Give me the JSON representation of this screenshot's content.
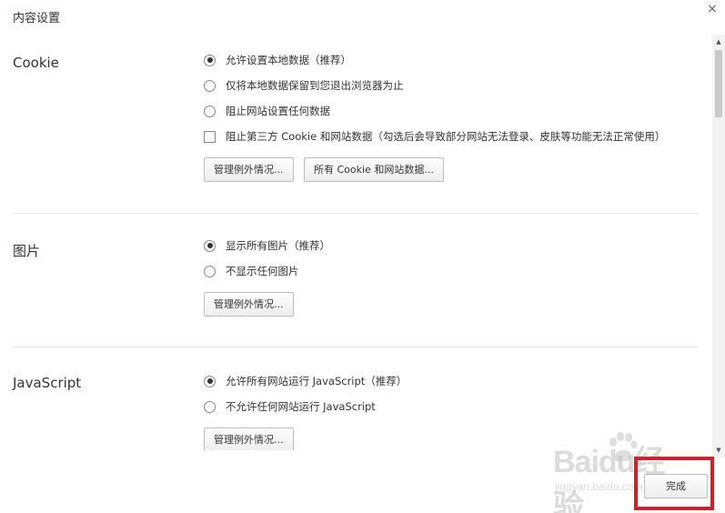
{
  "dialog": {
    "title": "内容设置",
    "close_glyph": "×"
  },
  "cookie": {
    "label": "Cookie",
    "options": [
      {
        "label": "允许设置本地数据（推荐）",
        "type": "radio",
        "checked": true
      },
      {
        "label": "仅将本地数据保留到您退出浏览器为止",
        "type": "radio",
        "checked": false
      },
      {
        "label": "阻止网站设置任何数据",
        "type": "radio",
        "checked": false
      },
      {
        "label": "阻止第三方 Cookie 和网站数据（勾选后会导致部分网站无法登录、皮肤等功能无法正常使用）",
        "type": "checkbox",
        "checked": false
      }
    ],
    "buttons": {
      "manage_exceptions": "管理例外情况...",
      "all_cookies": "所有 Cookie 和网站数据..."
    }
  },
  "images": {
    "label": "图片",
    "options": [
      {
        "label": "显示所有图片（推荐）",
        "type": "radio",
        "checked": true
      },
      {
        "label": "不显示任何图片",
        "type": "radio",
        "checked": false
      }
    ],
    "buttons": {
      "manage_exceptions": "管理例外情况..."
    }
  },
  "javascript": {
    "label": "JavaScript",
    "options": [
      {
        "label": "允许所有网站运行 JavaScript（推荐）",
        "type": "radio",
        "checked": true
      },
      {
        "label": "不允许任何网站运行 JavaScript",
        "type": "radio",
        "checked": false
      }
    ],
    "buttons": {
      "manage_exceptions": "管理例外情况..."
    }
  },
  "footer": {
    "done_label": "完成"
  },
  "watermark": {
    "main": "Baidu经验",
    "sub": "jingyan.baidu.com"
  },
  "colors": {
    "highlight": "#d31f2c"
  },
  "icons": {
    "close": "close-icon",
    "scroll_up": "scroll-up-icon",
    "scroll_down": "scroll-down-icon",
    "paw": "baidu-paw-icon"
  }
}
